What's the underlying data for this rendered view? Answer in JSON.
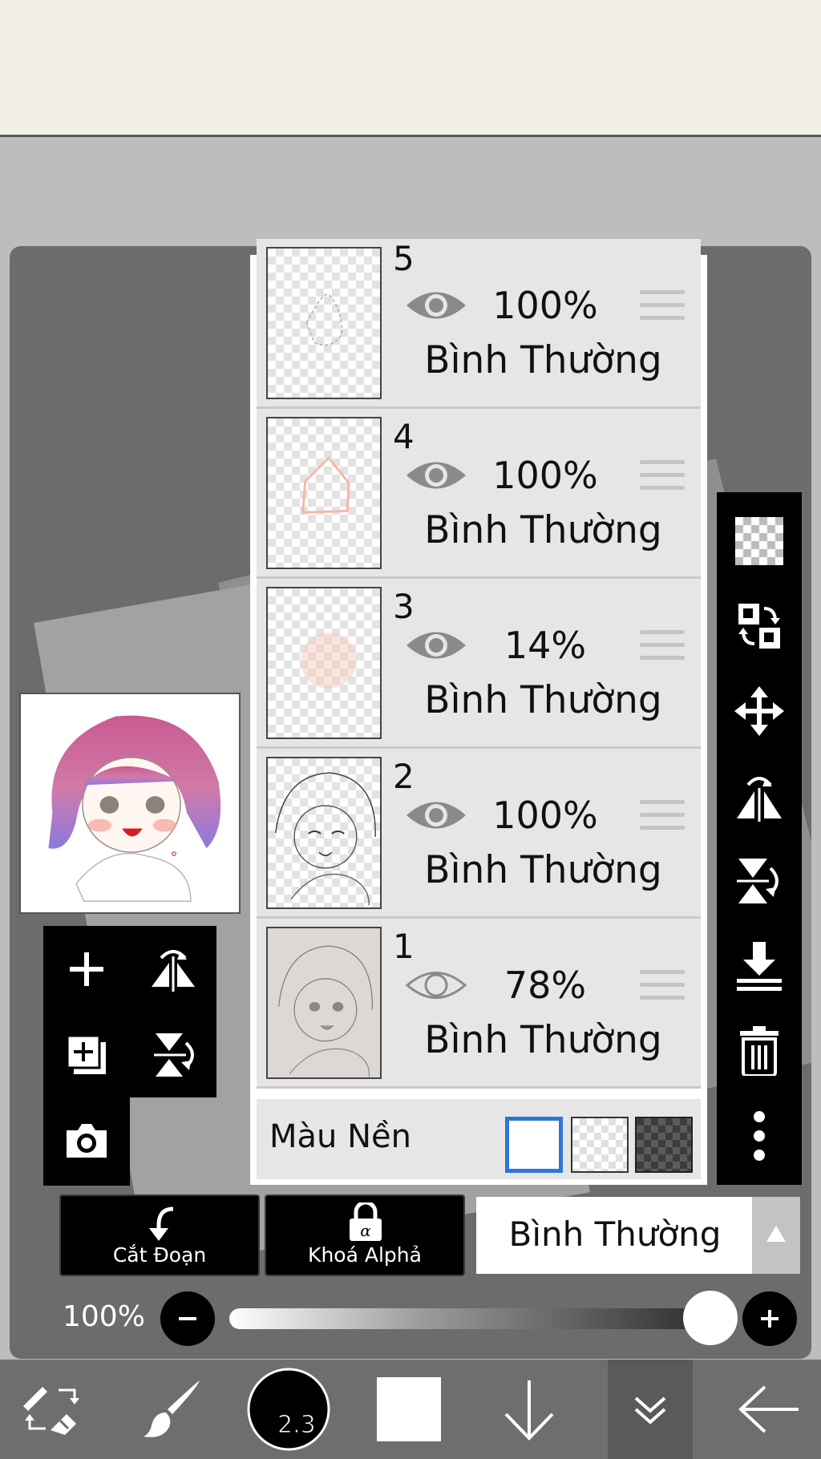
{
  "layers_panel": {
    "layers": [
      {
        "number": "5",
        "opacity": "100%",
        "blend_mode": "Bình Thường",
        "visible": true
      },
      {
        "number": "4",
        "opacity": "100%",
        "blend_mode": "Bình Thường",
        "visible": true
      },
      {
        "number": "3",
        "opacity": "14%",
        "blend_mode": "Bình Thường",
        "visible": true
      },
      {
        "number": "2",
        "opacity": "100%",
        "blend_mode": "Bình Thường",
        "visible": true
      },
      {
        "number": "1",
        "opacity": "78%",
        "blend_mode": "Bình Thường",
        "visible": false
      }
    ],
    "background_color_label": "Màu Nền",
    "background_options": [
      "white",
      "transparent",
      "dark"
    ],
    "background_selected": "white"
  },
  "right_toolbar": {
    "icons": [
      "transparency-checker-icon",
      "swap-layer-icon",
      "move-icon",
      "flip-horizontal-icon",
      "flip-vertical-icon",
      "merge-down-icon",
      "trash-icon",
      "more-vertical-icon"
    ]
  },
  "left_toolbar": {
    "icons": [
      "add-icon",
      "flip-horizontal-icon",
      "duplicate-layer-icon",
      "flip-vertical-icon",
      "camera-icon"
    ]
  },
  "bottom_actions": {
    "clip_label": "Cắt Đoạn",
    "alpha_lock_label": "Khoá Alphả",
    "blend_mode": "Bình Thường"
  },
  "opacity_slider": {
    "label": "100%",
    "value": 1.0
  },
  "bottom_nav": {
    "brush_size": "2.3",
    "color": "#ffffff",
    "icons": [
      "transform-eraser-icon",
      "brush-icon",
      "brush-size-icon",
      "color-swatch-icon",
      "arrow-down-icon",
      "double-chevron-down-icon",
      "back-arrow-icon"
    ]
  },
  "colors": {
    "accent_selected": "#2f76d8",
    "toolbar_bg": "#000000",
    "panel_bg": "#e6e6e6"
  }
}
